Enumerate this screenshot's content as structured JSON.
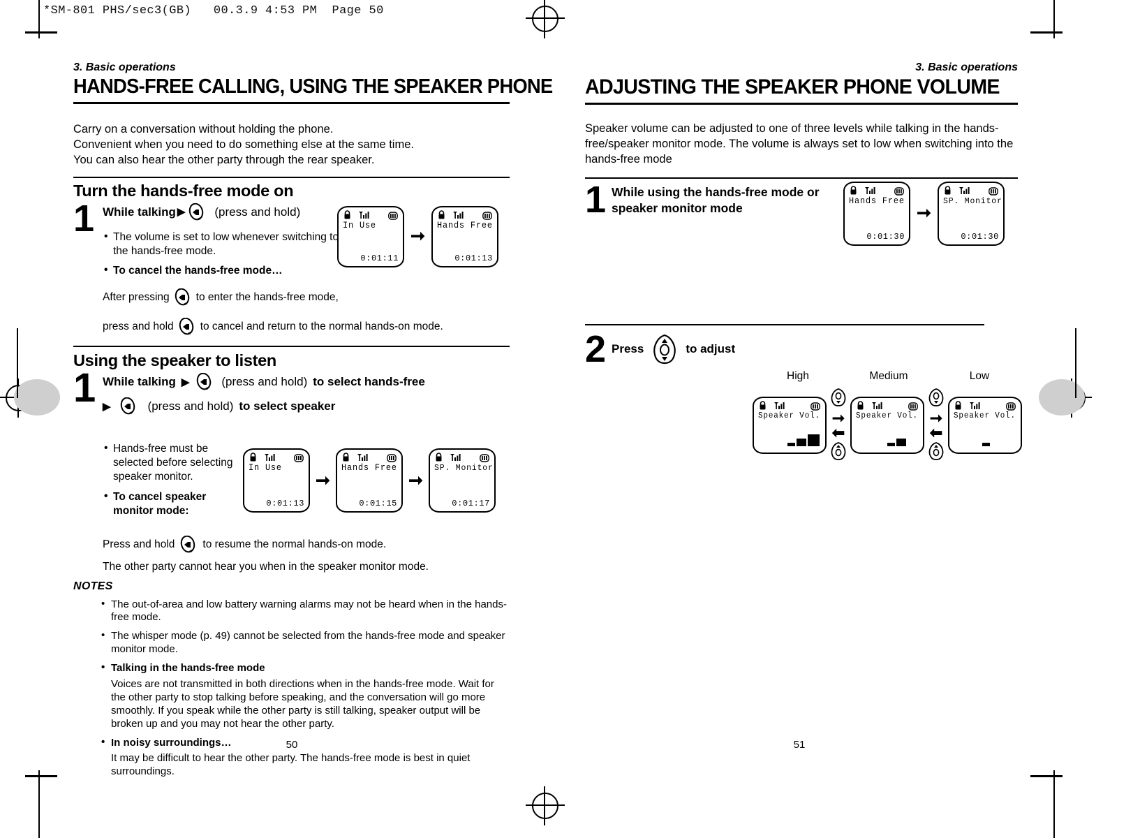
{
  "film_header": "*SM-801 PHS/sec3(GB)   00.3.9 4:53 PM  Page 50",
  "left_page": {
    "chapter": "3. Basic operations",
    "title": "HANDS-FREE CALLING, USING THE SPEAKER PHONE",
    "intro": [
      "Carry on a conversation without holding the phone.",
      "Convenient when you need to do something else at the same time.",
      "You can also hear the other party through the rear speaker."
    ],
    "section1": {
      "heading": "Turn the hands-free mode on",
      "step_number": "1",
      "step_title_a": "While talking",
      "step_title_b": "(press and hold)",
      "bullets": [
        "The volume is set to low whenever switching to the hands-free mode.",
        "To cancel the hands-free mode…"
      ],
      "line_a": "After pressing",
      "line_a_end": "to enter the hands-free mode,",
      "line_b": "press and hold",
      "line_b_end": "to cancel and return to the normal hands-on mode.",
      "screens": [
        {
          "text": "In Use",
          "timer": "0:01:11",
          "battery": "full"
        },
        {
          "text": "Hands Free",
          "timer": "0:01:13",
          "battery": "full"
        }
      ]
    },
    "section2": {
      "heading": "Using the speaker to listen",
      "step_number": "1",
      "line1_a": "While talking",
      "line1_b": "(press and hold)",
      "line1_c": "to select hands-free",
      "line2_b": "(press and hold)",
      "line2_c": "to select speaker",
      "bullets": [
        "Hands-free must be selected before selecting speaker monitor.",
        "To cancel speaker monitor mode:"
      ],
      "line_c": "Press and hold",
      "line_c_end": "to resume the normal hands-on mode.",
      "line_d": "The other party cannot hear you when in the speaker monitor mode.",
      "screens": [
        {
          "text": "In Use",
          "timer": "0:01:13",
          "battery": "full"
        },
        {
          "text": "Hands Free",
          "timer": "0:01:15",
          "battery": "full"
        },
        {
          "text": "SP. Monitor",
          "timer": "0:01:17",
          "battery": "full"
        }
      ]
    },
    "notes": {
      "heading": "NOTES",
      "items": [
        {
          "bold": false,
          "text": "The out-of-area and low battery warning alarms may not be heard when in the hands-free mode."
        },
        {
          "bold": false,
          "text": "The whisper mode (p. 49) cannot be selected from the hands-free mode and speaker monitor mode."
        },
        {
          "bold": true,
          "text": "Talking in the hands-free mode"
        },
        {
          "bold": false,
          "indent": true,
          "text": "Voices are not transmitted in both directions when in the hands-free mode. Wait for the other party to stop talking before speaking, and the conversation will go more smoothly. If you speak while the other party is still talking, speaker output will be broken up and you may not hear the other party."
        },
        {
          "bold": true,
          "text": "In noisy surroundings…"
        },
        {
          "bold": false,
          "indent": true,
          "text": "It may be difficult to hear the other party. The hands-free mode is best in quiet surroundings."
        }
      ]
    },
    "page_number": "50"
  },
  "right_page": {
    "chapter": "3. Basic operations",
    "title": "ADJUSTING THE SPEAKER PHONE VOLUME",
    "intro": [
      "Speaker volume can be adjusted to one of three levels while talking in the hands-",
      "free/speaker monitor mode. The volume is always set to low when switching into the",
      "hands-free mode"
    ],
    "step1": {
      "step_number": "1",
      "title_line1": "While using the hands-free mode or",
      "title_line2": "speaker monitor mode",
      "screens": [
        {
          "text": "Hands Free",
          "timer": "0:01:30",
          "battery": "full"
        },
        {
          "text": "SP. Monitor",
          "timer": "0:01:30",
          "battery": "full"
        }
      ]
    },
    "step2": {
      "step_number": "2",
      "label_a": "Press",
      "label_b": "to adjust",
      "levels": [
        {
          "label": "High",
          "screen_text": "Speaker Vol.",
          "bars": 3
        },
        {
          "label": "Medium",
          "screen_text": "Speaker Vol.",
          "bars": 2
        },
        {
          "label": "Low",
          "screen_text": "Speaker Vol.",
          "bars": 1
        }
      ]
    },
    "page_number": "51"
  }
}
